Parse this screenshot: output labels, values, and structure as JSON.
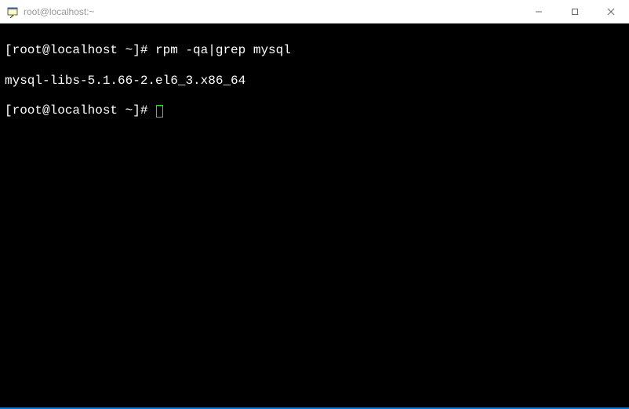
{
  "window": {
    "title": "root@localhost:~"
  },
  "terminal": {
    "line1_prompt": "[root@localhost ~]# ",
    "line1_cmd": "rpm -qa|grep mysql",
    "line2_output": "mysql-libs-5.1.66-2.el6_3.x86_64",
    "line3_prompt": "[root@localhost ~]# "
  },
  "icons": {
    "app": "putty-icon",
    "minimize": "—",
    "maximize": "☐",
    "close": "✕"
  }
}
